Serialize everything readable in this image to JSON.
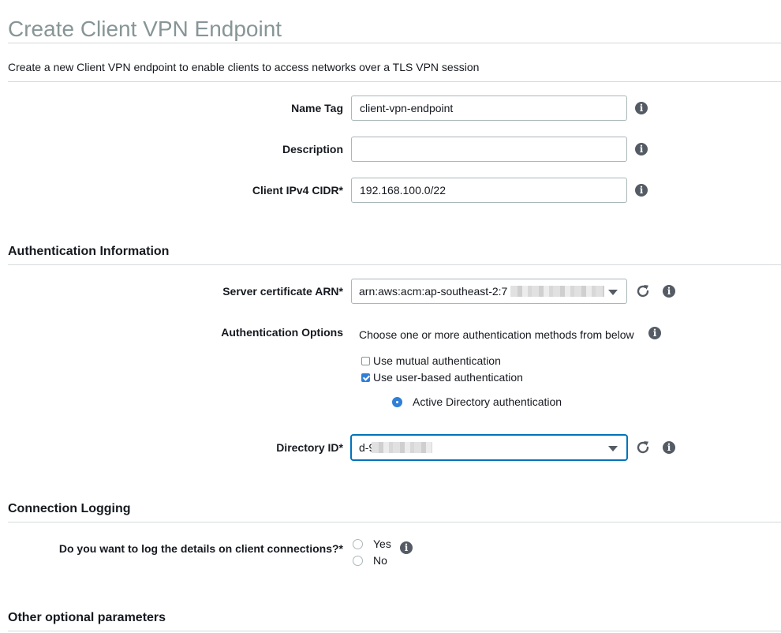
{
  "page": {
    "title": "Create Client VPN Endpoint",
    "subtitle": "Create a new Client VPN endpoint to enable clients to access networks over a TLS VPN session"
  },
  "form": {
    "name_tag": {
      "label": "Name Tag",
      "value": "client-vpn-endpoint",
      "icon": "info-icon"
    },
    "description": {
      "label": "Description",
      "value": "",
      "icon": "info-icon"
    },
    "client_cidr": {
      "label": "Client IPv4 CIDR*",
      "value": "192.168.100.0/22",
      "icon": "info-icon"
    }
  },
  "auth_section": {
    "title": "Authentication Information",
    "server_cert": {
      "label": "Server certificate ARN*",
      "value": "arn:aws:acm:ap-southeast-2:7"
    },
    "options": {
      "label": "Authentication Options",
      "hint": "Choose one or more authentication methods from below",
      "mutual": {
        "label": "Use mutual authentication",
        "checked": false
      },
      "user_based": {
        "label": "Use user-based authentication",
        "checked": true
      },
      "active_directory": {
        "label": "Active Directory authentication",
        "selected": true
      }
    },
    "directory_id": {
      "label": "Directory ID*",
      "value": "d-9"
    }
  },
  "logging_section": {
    "title": "Connection Logging",
    "question": "Do you want to log the details on client connections?*",
    "options": [
      "Yes",
      "No"
    ]
  },
  "optional_section": {
    "title": "Other optional parameters"
  },
  "colors": {
    "accent": "#2f7fd8",
    "focus": "#0073bb",
    "muted_title": "#879596",
    "icon": "#545b64"
  }
}
